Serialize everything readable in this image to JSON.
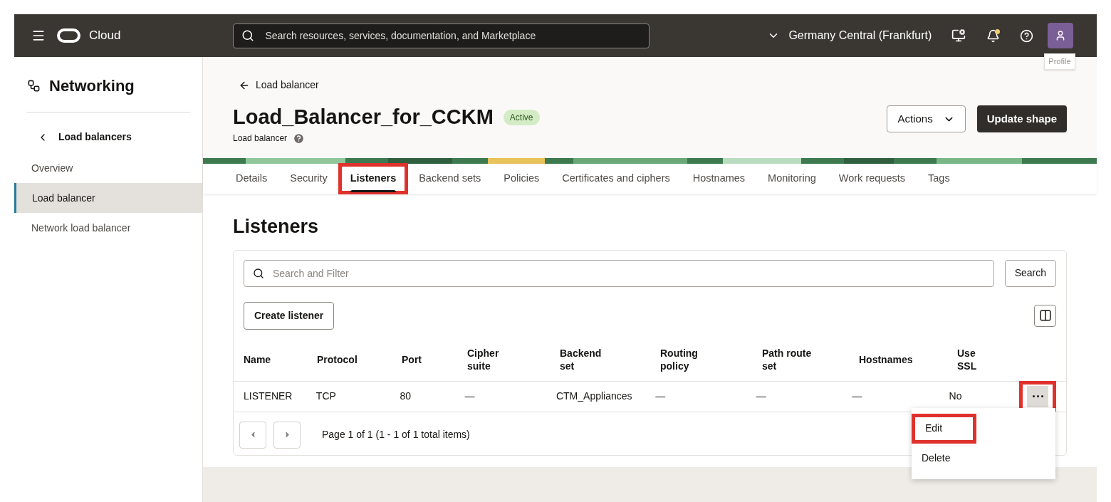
{
  "topbar": {
    "brand": "Cloud",
    "search": {
      "placeholder": "Search resources, services, documentation, and Marketplace"
    },
    "region": "Germany Central (Frankfurt)",
    "notification_dot": true,
    "profile_tooltip": "Profile"
  },
  "sidebar": {
    "title": "Networking",
    "back_link": "Load balancers",
    "items": [
      {
        "label": "Overview",
        "selected": false
      },
      {
        "label": "Load balancer",
        "selected": true
      },
      {
        "label": "Network load balancer",
        "selected": false
      }
    ]
  },
  "header": {
    "breadcrumb": "Load balancer",
    "title": "Load_Balancer_for_CCKM",
    "status": "Active",
    "subtitle": "Load balancer",
    "buttons": [
      {
        "label": "Actions",
        "kind": "dropdown"
      },
      {
        "label": "Update shape",
        "kind": "primary"
      }
    ]
  },
  "tabs": [
    {
      "label": "Details",
      "selected": false,
      "highlighted": false
    },
    {
      "label": "Security",
      "selected": false,
      "highlighted": false
    },
    {
      "label": "Listeners",
      "selected": true,
      "highlighted": true
    },
    {
      "label": "Backend sets",
      "selected": false,
      "highlighted": false
    },
    {
      "label": "Policies",
      "selected": false,
      "highlighted": false
    },
    {
      "label": "Certificates and ciphers",
      "selected": false,
      "highlighted": false
    },
    {
      "label": "Hostnames",
      "selected": false,
      "highlighted": false
    },
    {
      "label": "Monitoring",
      "selected": false,
      "highlighted": false
    },
    {
      "label": "Work requests",
      "selected": false,
      "highlighted": false
    },
    {
      "label": "Tags",
      "selected": false,
      "highlighted": false
    }
  ],
  "section": {
    "title": "Listeners",
    "filter": {
      "placeholder": "Search and Filter"
    },
    "search_button": "Search",
    "create_button": "Create listener",
    "table": {
      "columns": [
        "Name",
        "Protocol",
        "Port",
        "Cipher suite",
        "Backend set",
        "Routing policy",
        "Path route set",
        "Hostnames",
        "Use SSL"
      ],
      "rows": [
        {
          "cells": [
            "LISTENER",
            "TCP",
            "80",
            "—",
            "CTM_Appliances",
            "—",
            "—",
            "—",
            "No"
          ],
          "menu_highlighted": true
        }
      ]
    },
    "pagination": "Page 1 of 1 (1 - 1 of 1 total items)"
  },
  "row_menu": {
    "items": [
      {
        "label": "Edit",
        "highlighted": true
      },
      {
        "label": "Delete",
        "highlighted": false
      }
    ]
  }
}
